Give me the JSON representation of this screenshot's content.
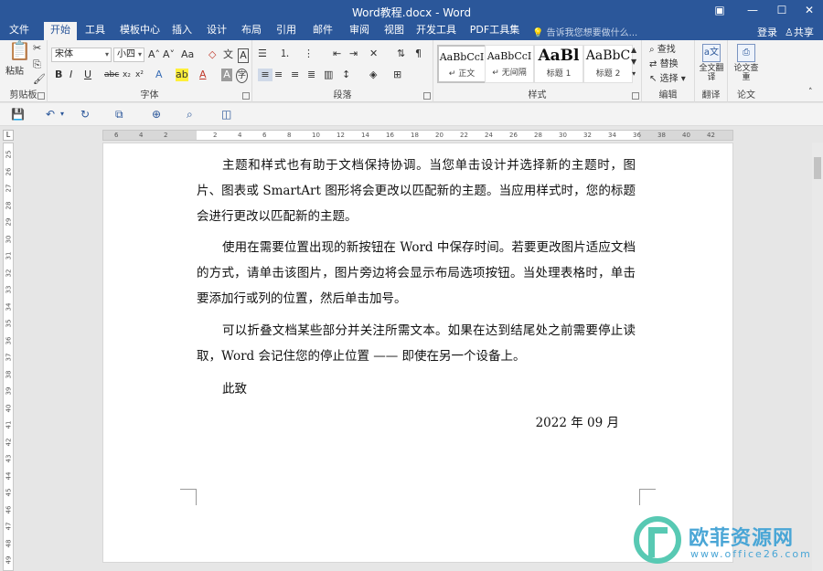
{
  "window": {
    "title": "Word教程.docx - Word",
    "buttons": [
      "▣",
      "—",
      "☐",
      "✕"
    ]
  },
  "tabs": [
    {
      "label": "文件"
    },
    {
      "label": "开始"
    },
    {
      "label": "工具"
    },
    {
      "label": "模板中心"
    },
    {
      "label": "插入"
    },
    {
      "label": "设计"
    },
    {
      "label": "布局"
    },
    {
      "label": "引用"
    },
    {
      "label": "邮件"
    },
    {
      "label": "审阅"
    },
    {
      "label": "视图"
    },
    {
      "label": "开发工具"
    },
    {
      "label": "PDF工具集"
    }
  ],
  "active_tab": "开始",
  "tell_me": "告诉我您想要做什么...",
  "signin": "登录",
  "share": "共享",
  "ribbon": {
    "clipboard": {
      "paste": "粘贴",
      "label": "剪贴板"
    },
    "font": {
      "name": "宋体",
      "size": "小四",
      "label": "字体"
    },
    "paragraph": {
      "label": "段落"
    },
    "styles": {
      "label": "样式",
      "items": [
        {
          "sample": "AaBbCcI",
          "name": "↵ 正文"
        },
        {
          "sample": "AaBbCcI",
          "name": "↵ 无间隔"
        },
        {
          "sample": "AaBl",
          "name": "标题 1"
        },
        {
          "sample": "AaBbC",
          "name": "标题 2"
        }
      ]
    },
    "editing": {
      "find": "查找",
      "replace": "替换",
      "select": "选择",
      "label": "编辑"
    },
    "translate": {
      "button": "全文翻译",
      "label": "翻译"
    },
    "paper": {
      "button": "论文查重",
      "label": "论文"
    }
  },
  "ruler": {
    "h_ticks": [
      "6",
      "4",
      "2",
      "",
      "2",
      "4",
      "6",
      "8",
      "10",
      "12",
      "14",
      "16",
      "18",
      "20",
      "22",
      "24",
      "26",
      "28",
      "30",
      "32",
      "34",
      "36",
      "38",
      "40",
      "42"
    ],
    "v_ticks": [
      "25",
      "26",
      "27",
      "28",
      "29",
      "30",
      "31",
      "32",
      "33",
      "34",
      "35",
      "36",
      "37",
      "38",
      "39",
      "40",
      "41",
      "42",
      "43",
      "44",
      "45",
      "46",
      "47",
      "48",
      "49"
    ]
  },
  "document": {
    "paragraphs": [
      "主题和样式也有助于文档保持协调。当您单击设计并选择新的主题时，图片、图表或 SmartArt 图形将会更改以匹配新的主题。当应用样式时，您的标题会进行更改以匹配新的主题。",
      "使用在需要位置出现的新按钮在 Word 中保存时间。若要更改图片适应文档的方式，请单击该图片，图片旁边将会显示布局选项按钮。当处理表格时，单击要添加行或列的位置，然后单击加号。",
      "可以折叠文档某些部分并关注所需文本。如果在达到结尾处之前需要停止读取，Word 会记住您的停止位置 —— 即使在另一个设备上。"
    ],
    "closing": "此致",
    "date": "2022 年 09 月"
  },
  "watermark": {
    "brand": "欧菲资源网",
    "url": "www.office26.com"
  }
}
